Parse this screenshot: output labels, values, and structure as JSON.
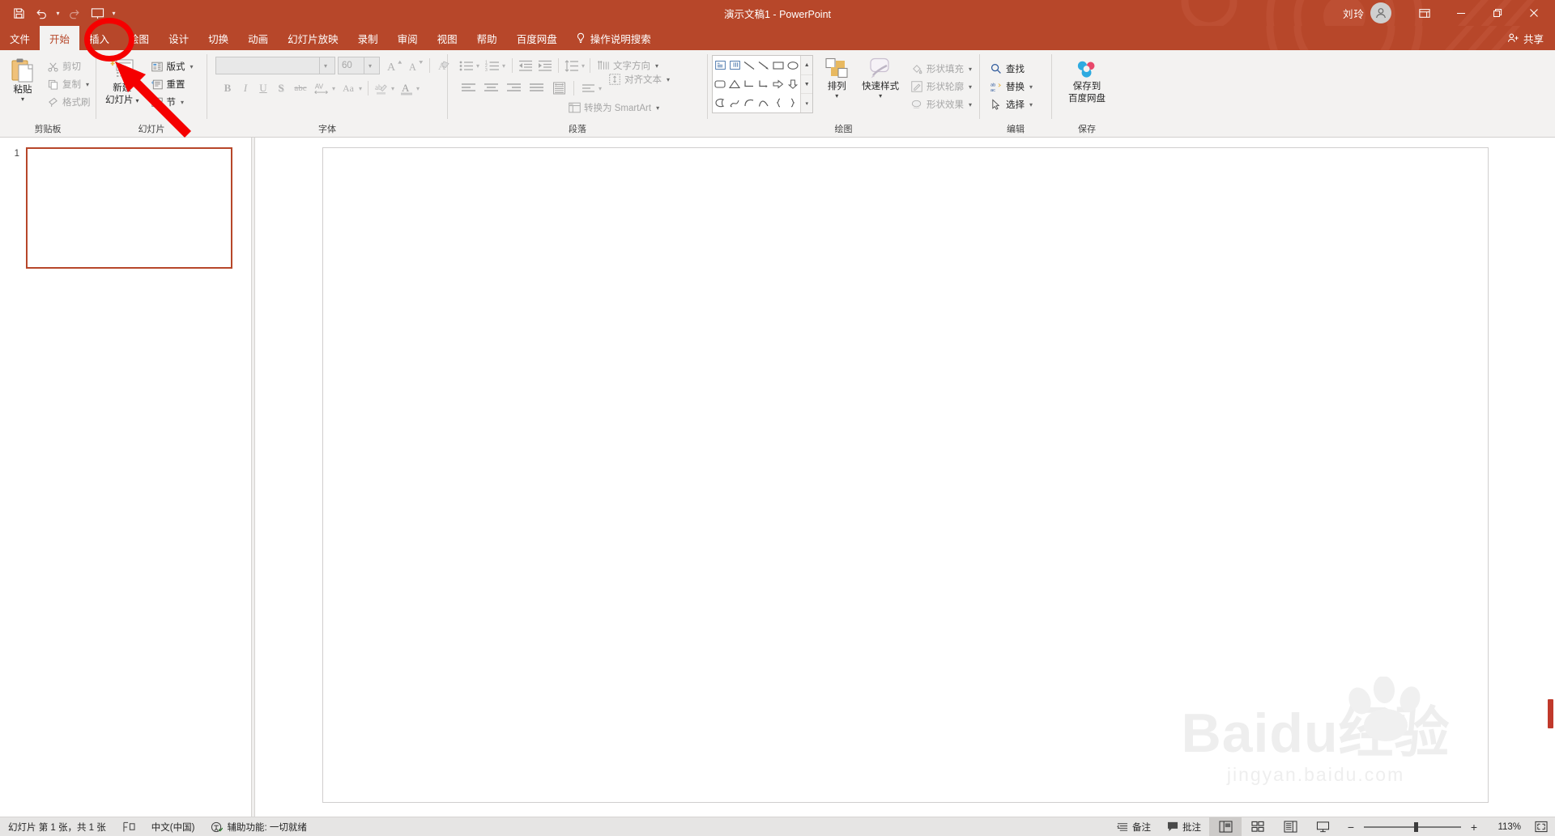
{
  "titlebar": {
    "qat": [
      {
        "name": "save-icon",
        "label": "保存"
      },
      {
        "name": "undo-icon",
        "label": "撤消"
      },
      {
        "name": "redo-icon",
        "label": "恢复"
      },
      {
        "name": "start-slideshow-icon",
        "label": "从头开始"
      }
    ],
    "document_title": "演示文稿1",
    "separator": "-",
    "app_name": "PowerPoint",
    "user_name": "刘玲",
    "ribbon_display_options": "功能区显示选项",
    "minimize": "最小化",
    "restore": "向下还原",
    "close": "关闭"
  },
  "tabs": [
    {
      "label": "文件",
      "active": false
    },
    {
      "label": "开始",
      "active": true
    },
    {
      "label": "插入",
      "active": false
    },
    {
      "label": "绘图",
      "active": false
    },
    {
      "label": "设计",
      "active": false
    },
    {
      "label": "切换",
      "active": false
    },
    {
      "label": "动画",
      "active": false
    },
    {
      "label": "幻灯片放映",
      "active": false
    },
    {
      "label": "录制",
      "active": false
    },
    {
      "label": "审阅",
      "active": false
    },
    {
      "label": "视图",
      "active": false
    },
    {
      "label": "帮助",
      "active": false
    },
    {
      "label": "百度网盘",
      "active": false
    }
  ],
  "tell_me": "操作说明搜索",
  "share": "共享",
  "ribbon": {
    "clipboard": {
      "label": "剪贴板",
      "paste": "粘贴",
      "cut": "剪切",
      "copy": "复制",
      "format_painter": "格式刷"
    },
    "slides": {
      "label": "幻灯片",
      "new_slide_line1": "新建",
      "new_slide_line2": "幻灯片",
      "layout": "版式",
      "reset": "重置",
      "section": "节"
    },
    "font": {
      "label": "字体",
      "font_name": "",
      "font_name_placeholder": "",
      "font_size": "60",
      "bold": "B",
      "italic": "I",
      "underline": "U",
      "shadow": "S",
      "strikethrough": "abc",
      "char_spacing": "AV",
      "change_case": "Aa",
      "clear_formatting": "清除所有格式",
      "grow_font": "增大字号",
      "shrink_font": "减小字号",
      "text_highlight": "文本突出显示颜色",
      "font_color": "字体颜色"
    },
    "paragraph": {
      "label": "段落",
      "bullets": "项目符号",
      "numbering": "编号",
      "decrease_indent": "减少缩进量",
      "increase_indent": "增加缩进量",
      "line_spacing": "行距",
      "align_left": "左对齐",
      "align_center": "居中",
      "align_right": "右对齐",
      "justify": "两端对齐",
      "columns": "分栏",
      "text_direction": "文字方向",
      "align_text": "对齐文本",
      "convert_smartart": "转换为 SmartArt"
    },
    "drawing": {
      "label": "绘图",
      "arrange": "排列",
      "quick_styles_line1": "快速样式",
      "shape_fill": "形状填充",
      "shape_outline": "形状轮廓",
      "shape_effects": "形状效果",
      "shapes_gallery": "形状库"
    },
    "editing": {
      "label": "编辑",
      "find": "查找",
      "replace": "替换",
      "select": "选择"
    },
    "save_group": {
      "label": "保存",
      "save_to_line1": "保存到",
      "save_to_line2": "百度网盘"
    }
  },
  "thumbnails": [
    {
      "number": "1"
    }
  ],
  "slide": {
    "watermark_main": "Baidu经验",
    "watermark_sub": "jingyan.baidu.com"
  },
  "statusbar": {
    "slide_count": "幻灯片 第 1 张，共 1 张",
    "spellcheck": "拼写检查",
    "language": "中文(中国)",
    "accessibility": "辅助功能: 一切就绪",
    "notes": "备注",
    "comments": "批注",
    "view_normal": "普通视图",
    "view_sorter": "幻灯片浏览",
    "view_reading": "阅读视图",
    "view_slideshow": "幻灯片放映",
    "zoom_out": "−",
    "zoom_in": "+",
    "zoom_level": "113%",
    "fit_slide": "使幻灯片适应当前窗口"
  },
  "annotations": {
    "ellipse_target": "插入",
    "arrow_target": "新建幻灯片"
  },
  "colors": {
    "brand": "#b7472a",
    "ribbon_bg": "#f3f2f1",
    "annotation_red": "#f50000",
    "thumb_border": "#b7472a"
  }
}
